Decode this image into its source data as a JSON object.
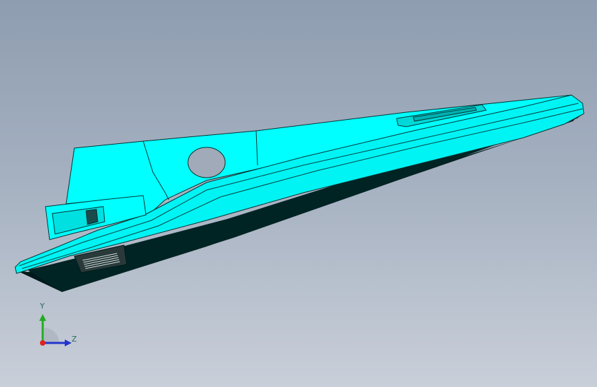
{
  "viewport": {
    "background_top": "#8e9db0",
    "background_bottom": "#c9cfd9",
    "model": {
      "face_color": "#00ffff",
      "shadow_color": "#001a1a",
      "edge_color": "#003333"
    }
  },
  "triad": {
    "y_label": "Y",
    "z_label": "Z",
    "y_color": "#22aa22",
    "z_color": "#2233cc",
    "x_color": "#dd2222"
  }
}
